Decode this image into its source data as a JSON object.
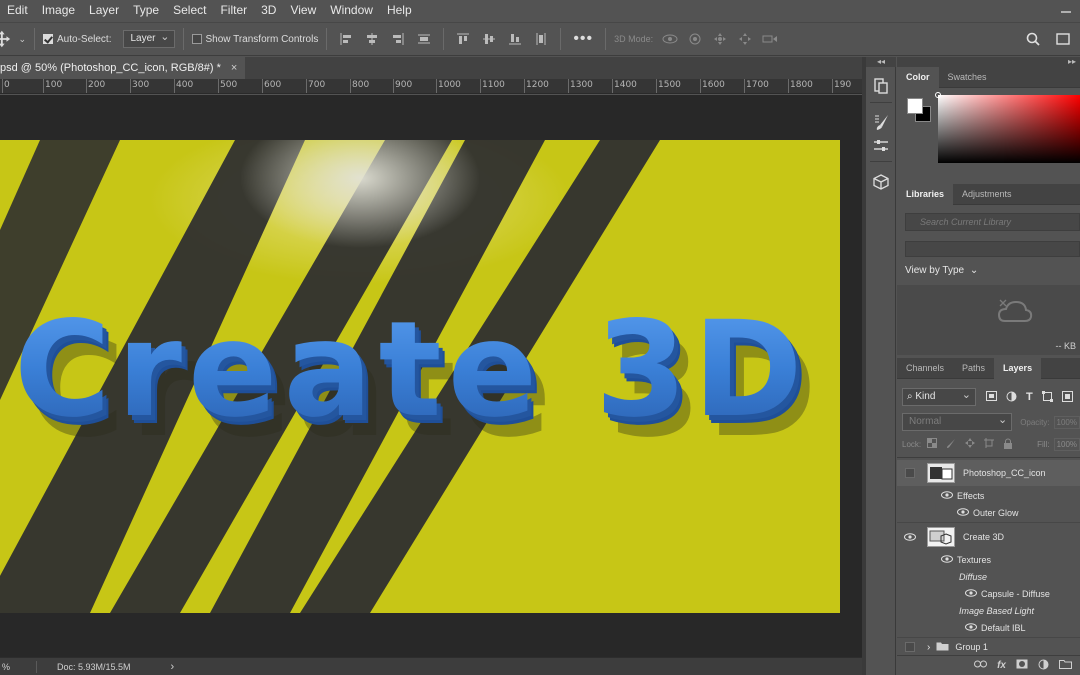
{
  "menu": [
    "Edit",
    "Image",
    "Layer",
    "Type",
    "Select",
    "Filter",
    "3D",
    "View",
    "Window",
    "Help"
  ],
  "options_bar": {
    "auto_select_label": "Auto-Select:",
    "auto_select_checked": true,
    "auto_select_target": "Layer",
    "show_transform_label": "Show Transform Controls",
    "show_transform_checked": false,
    "mode_3d_label": "3D Mode:"
  },
  "document": {
    "tab_title": "psd @ 50% (Photoshop_CC_icon, RGB/8#) *",
    "canvas_text": "Create 3D",
    "canvas_bg_color": "#c7c616",
    "text_color": "#3a7fd6"
  },
  "ruler": {
    "ticks": [
      "0",
      "100",
      "200",
      "300",
      "400",
      "500",
      "600",
      "700",
      "800",
      "900",
      "1000",
      "1100",
      "1200",
      "1300",
      "1400",
      "1500",
      "1600",
      "1700",
      "1800",
      "190"
    ]
  },
  "status": {
    "zoom": "%",
    "doc": "Doc: 5.93M/15.5M",
    "arrow": "›"
  },
  "color_panel": {
    "tabs": [
      "Color",
      "Swatches"
    ],
    "foreground": "#ffffff",
    "background": "#000000"
  },
  "libraries_panel": {
    "tabs": [
      "Libraries",
      "Adjustments"
    ],
    "search_placeholder": "Search Current Library",
    "view_by": "View by Type",
    "size": "-- KB"
  },
  "layers_panel": {
    "tabs": [
      "Channels",
      "Paths",
      "Layers"
    ],
    "filter_kind": "Kind",
    "blend_mode": "Normal",
    "opacity_label": "Opacity:",
    "opacity_value": "100%",
    "lock_label": "Lock:",
    "fill_label": "Fill:",
    "fill_value": "100%",
    "rows": [
      {
        "name": "Photoshop_CC_icon",
        "type": "layer",
        "visible": false
      },
      {
        "name": "Effects",
        "type": "sub",
        "visible": true
      },
      {
        "name": "Outer Glow",
        "type": "subsub",
        "visible": true
      },
      {
        "name": "Create 3D",
        "type": "layer",
        "visible": true
      },
      {
        "name": "Textures",
        "type": "sub",
        "visible": true
      },
      {
        "name": "Diffuse",
        "type": "label"
      },
      {
        "name": "Capsule - Diffuse",
        "type": "subsub",
        "visible": true
      },
      {
        "name": "Image Based Light",
        "type": "label"
      },
      {
        "name": "Default IBL",
        "type": "subsub",
        "visible": true
      },
      {
        "name": "Group 1",
        "type": "group",
        "visible": false
      }
    ]
  },
  "icons": [
    "move-tool-icon",
    "search-icon",
    "workspace-icon",
    "history-icon",
    "brush-icon",
    "adjust-icon",
    "3d-cube-icon",
    "eye-icon",
    "folder-icon",
    "link-icon",
    "fx-icon",
    "mask-icon",
    "adjustment-layer-icon",
    "new-group-icon"
  ]
}
